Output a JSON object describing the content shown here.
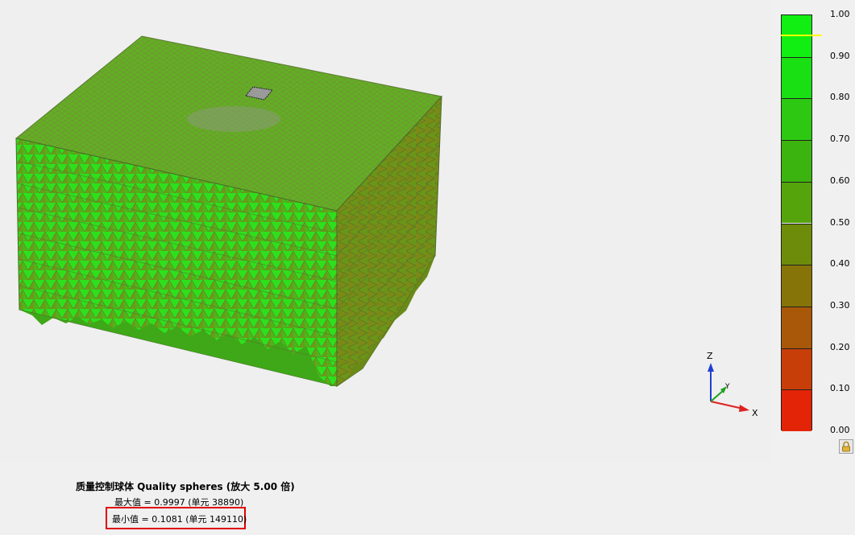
{
  "view": {
    "mesh_colors": [
      "#22ee22",
      "#44cc10",
      "#5aaa12",
      "#6e8e14",
      "#8a7012",
      "#3f9e16",
      "#2fd61a"
    ],
    "axes": {
      "z_label": "Z",
      "y_label": "Y",
      "x_label": "X"
    }
  },
  "legend": {
    "ticks": [
      "1.00",
      "0.90",
      "0.80",
      "0.70",
      "0.60",
      "0.50",
      "0.40",
      "0.30",
      "0.20",
      "0.10",
      "0.00"
    ],
    "segment_colors": [
      "#11ee11",
      "#19e012",
      "#2cc812",
      "#3cb40f",
      "#55a40c",
      "#6d8c0a",
      "#867409",
      "#a85808",
      "#c83e08",
      "#e42407",
      "#ff0606"
    ],
    "marker_value": 0.95,
    "marker_color": "#ffff00",
    "lock_icon": "lock-icon"
  },
  "info": {
    "title": "质量控制球体 Quality spheres (放大 5.00 倍)",
    "max_line": "最大值 = 0.9997 (单元 38890)",
    "min_line": "最小值 = 0.1081 (单元 149110)",
    "highlight_color": "#e00000"
  }
}
